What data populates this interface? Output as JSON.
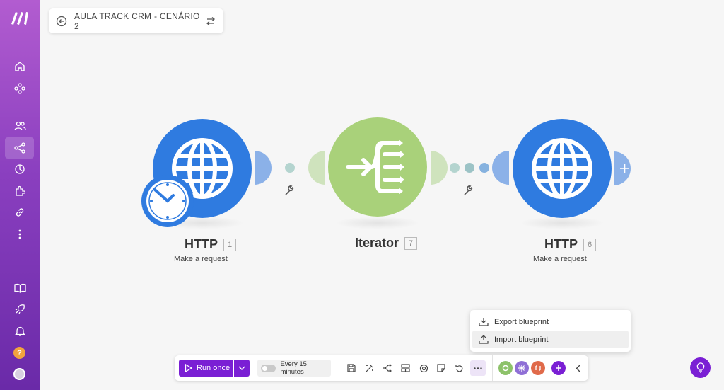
{
  "scenario": {
    "title": "AULA TRACK CRM - CENÁRIO 2"
  },
  "modules": [
    {
      "name": "HTTP",
      "number": "1",
      "subtitle": "Make a request",
      "icon": "globe-icon",
      "color": "#2f7be0"
    },
    {
      "name": "Iterator",
      "number": "7",
      "subtitle": "",
      "icon": "iterator-icon",
      "color": "#a9d17a"
    },
    {
      "name": "HTTP",
      "number": "6",
      "subtitle": "Make a request",
      "icon": "globe-icon",
      "color": "#2f7be0"
    }
  ],
  "toolbar": {
    "run_label": "Run once",
    "schedule_label": "Every 15 minutes"
  },
  "menu": {
    "items": [
      {
        "label": "Export blueprint",
        "icon": "download-icon"
      },
      {
        "label": "Import blueprint",
        "icon": "upload-icon"
      }
    ]
  },
  "sidebar": {
    "items": [
      "home-icon",
      "org-icon",
      "team-icon",
      "scenarios-icon",
      "templates-icon",
      "apps-icon",
      "connections-icon",
      "more-icon",
      "docs-icon",
      "whats-new-icon",
      "notifications-icon",
      "help-icon",
      "avatar"
    ],
    "help_label": "?"
  },
  "colors": {
    "accent": "#7a1fd4",
    "http_blue": "#2f7be0",
    "iterator_green": "#a9d17a",
    "sidebar_top": "#b25cd0",
    "sidebar_bottom": "#6a2aa8"
  }
}
